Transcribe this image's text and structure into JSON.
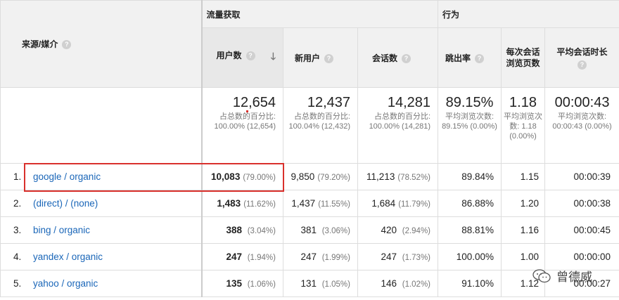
{
  "header": {
    "dimension": "来源/媒介",
    "group_acquisition": "流量获取",
    "group_behavior": "行为",
    "columns": {
      "users": "用户数",
      "new_users": "新用户",
      "sessions": "会话数",
      "bounce_rate": "跳出率",
      "pages_per_session": "每次会话浏览页数",
      "avg_duration": "平均会话时长"
    },
    "help": "?",
    "sort_icon": "sort-down-arrow"
  },
  "totals": {
    "users": {
      "value": "12,654",
      "sub": "占总数的百分比: 100.00% (12,654)"
    },
    "new_users": {
      "value": "12,437",
      "sub": "占总数的百分比: 100.04% (12,432)"
    },
    "sessions": {
      "value": "14,281",
      "sub": "占总数的百分比: 100.00% (14,281)"
    },
    "bounce_rate": {
      "value": "89.15%",
      "sub": "平均浏览次数: 89.15% (0.00%)"
    },
    "pages_per_session": {
      "value": "1.18",
      "sub": "平均浏览次数: 1.18 (0.00%)"
    },
    "avg_duration": {
      "value": "00:00:43",
      "sub": "平均浏览次数: 00:00:43 (0.00%)"
    }
  },
  "rows": [
    {
      "idx": "1.",
      "source": "google / organic",
      "users": "10,083",
      "users_pct": "(79.00%)",
      "new_users": "9,850",
      "new_users_pct": "(79.20%)",
      "sessions": "11,213",
      "sessions_pct": "(78.52%)",
      "bounce": "89.84%",
      "pages": "1.15",
      "duration": "00:00:39"
    },
    {
      "idx": "2.",
      "source": "(direct) / (none)",
      "users": "1,483",
      "users_pct": "(11.62%)",
      "new_users": "1,437",
      "new_users_pct": "(11.55%)",
      "sessions": "1,684",
      "sessions_pct": "(11.79%)",
      "bounce": "86.88%",
      "pages": "1.20",
      "duration": "00:00:38"
    },
    {
      "idx": "3.",
      "source": "bing / organic",
      "users": "388",
      "users_pct": "(3.04%)",
      "new_users": "381",
      "new_users_pct": "(3.06%)",
      "sessions": "420",
      "sessions_pct": "(2.94%)",
      "bounce": "88.81%",
      "pages": "1.16",
      "duration": "00:00:45"
    },
    {
      "idx": "4.",
      "source": "yandex / organic",
      "users": "247",
      "users_pct": "(1.94%)",
      "new_users": "247",
      "new_users_pct": "(1.99%)",
      "sessions": "247",
      "sessions_pct": "(1.73%)",
      "bounce": "100.00%",
      "pages": "1.00",
      "duration": "00:00:00"
    },
    {
      "idx": "5.",
      "source": "yahoo / organic",
      "users": "135",
      "users_pct": "(1.06%)",
      "new_users": "131",
      "new_users_pct": "(1.05%)",
      "sessions": "146",
      "sessions_pct": "(1.02%)",
      "bounce": "91.10%",
      "pages": "1.12",
      "duration": "00:00:27"
    }
  ],
  "watermark": {
    "text": "曾德威",
    "icon": "wechat-icon"
  },
  "colors": {
    "link": "#1a66b8",
    "highlight": "#d9302c",
    "header_bg": "#f1f1f1"
  }
}
